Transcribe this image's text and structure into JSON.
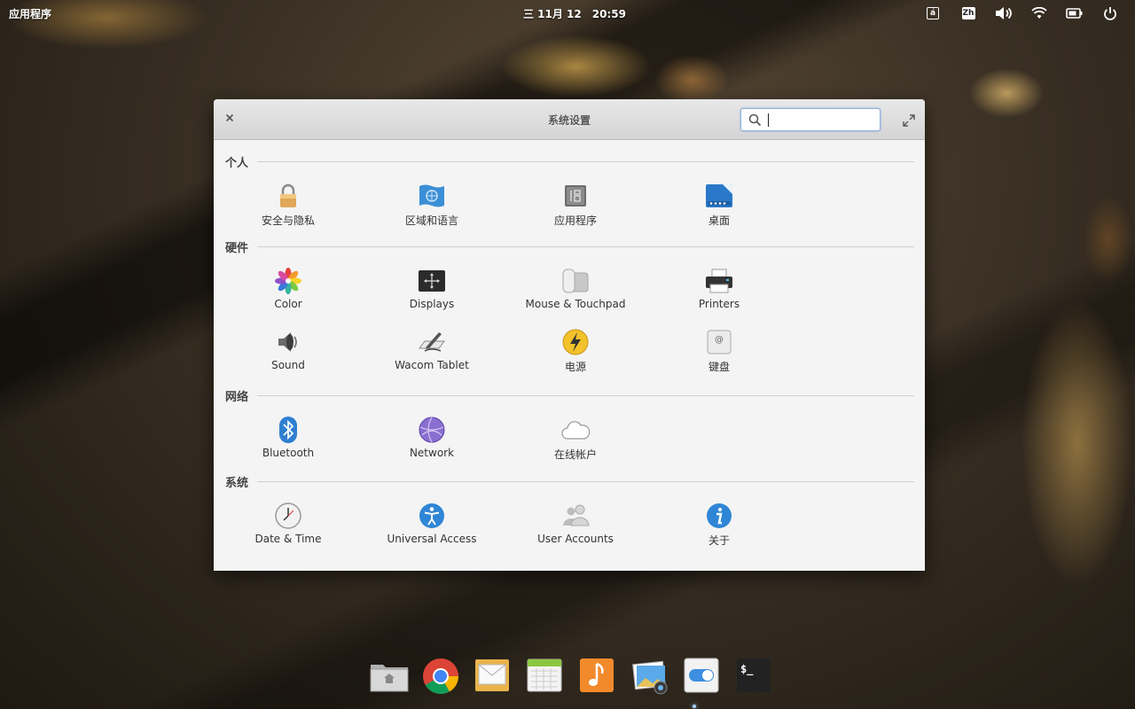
{
  "top_panel": {
    "apps_menu": "应用程序",
    "date": "三 11月 12",
    "time": "20:59",
    "indicators": [
      {
        "name": "keyboard-layout-icon",
        "text": "á"
      },
      {
        "name": "input-method-icon",
        "text": "Zh"
      },
      {
        "name": "volume-icon"
      },
      {
        "name": "wifi-icon"
      },
      {
        "name": "battery-icon"
      },
      {
        "name": "power-icon"
      }
    ]
  },
  "window": {
    "title": "系统设置",
    "search": {
      "value": "",
      "placeholder": ""
    }
  },
  "sections": [
    {
      "title": "个人",
      "items": [
        {
          "label": "安全与隐私",
          "icon": "lock-icon"
        },
        {
          "label": "区域和语言",
          "icon": "region-flag-icon"
        },
        {
          "label": "应用程序",
          "icon": "applications-icon"
        },
        {
          "label": "桌面",
          "icon": "desktop-icon"
        }
      ]
    },
    {
      "title": "硬件",
      "items": [
        {
          "label": "Color",
          "icon": "color-icon"
        },
        {
          "label": "Displays",
          "icon": "displays-icon"
        },
        {
          "label": "Mouse & Touchpad",
          "icon": "mouse-icon"
        },
        {
          "label": "Printers",
          "icon": "printer-icon"
        },
        {
          "label": "Sound",
          "icon": "speaker-icon"
        },
        {
          "label": "Wacom Tablet",
          "icon": "tablet-icon"
        },
        {
          "label": "电源",
          "icon": "power-bolt-icon"
        },
        {
          "label": "键盘",
          "icon": "keyboard-icon"
        }
      ]
    },
    {
      "title": "网络",
      "items": [
        {
          "label": "Bluetooth",
          "icon": "bluetooth-icon"
        },
        {
          "label": "Network",
          "icon": "network-globe-icon"
        },
        {
          "label": "在线帐户",
          "icon": "cloud-icon"
        }
      ]
    },
    {
      "title": "系统",
      "items": [
        {
          "label": "Date & Time",
          "icon": "clock-icon"
        },
        {
          "label": "Universal Access",
          "icon": "accessibility-icon"
        },
        {
          "label": "User Accounts",
          "icon": "users-icon"
        },
        {
          "label": "关于",
          "icon": "info-icon"
        }
      ]
    }
  ],
  "dock": [
    {
      "name": "files-icon"
    },
    {
      "name": "chrome-icon"
    },
    {
      "name": "mail-icon"
    },
    {
      "name": "calendar-icon"
    },
    {
      "name": "music-icon"
    },
    {
      "name": "photos-icon"
    },
    {
      "name": "settings-toggle-icon"
    },
    {
      "name": "terminal-icon"
    }
  ]
}
